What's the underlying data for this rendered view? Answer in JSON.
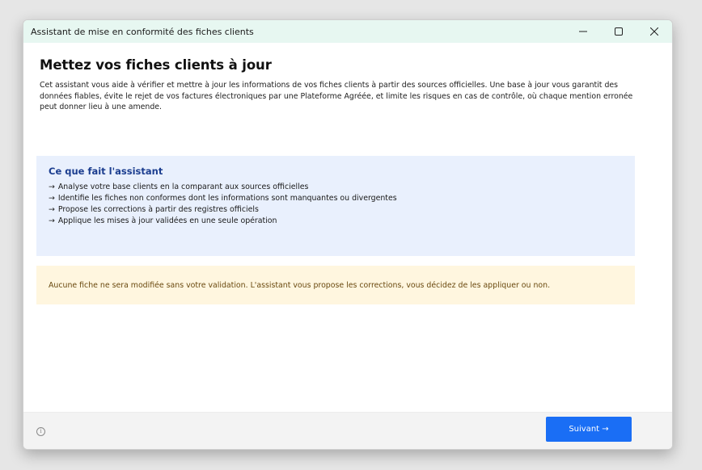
{
  "window": {
    "title": "Assistant de mise en conformité des fiches clients",
    "controls": {
      "minimize": "—",
      "maximize": "☐",
      "close": "✕"
    }
  },
  "page": {
    "title": "Mettez vos fiches clients à jour",
    "intro": "Cet assistant vous aide à vérifier et mettre à jour les informations de vos fiches clients à partir des sources officielles. Une base à jour vous garantit des données fiables, évite le rejet de vos factures électroniques par une Plateforme Agréée, et limite les risques en cas de contrôle, où chaque mention erronée peut donner lieu à une amende."
  },
  "info_box": {
    "heading": "Ce que fait l'assistant",
    "bullet_glyph": "→",
    "items": [
      "Analyse votre base clients en la comparant aux sources officielles",
      "Identifie les fiches non conformes dont les informations sont manquantes ou divergentes",
      "Propose les corrections à partir des registres officiels",
      "Applique les mises à jour validées en une seule opération"
    ]
  },
  "notice": {
    "text": "Aucune fiche ne sera modifiée sans votre validation. L'assistant vous propose les corrections, vous décidez de les appliquer ou non."
  },
  "footer": {
    "info_icon_glyph": "i",
    "next_label": "Suivant →"
  },
  "colors": {
    "titlebar_bg": "#e7f7f1",
    "info_bg": "#e9f0fd",
    "info_heading": "#1b3d8f",
    "notice_bg": "#fff6df",
    "notice_text": "#6a4a10",
    "primary_button": "#1a6ef5"
  }
}
